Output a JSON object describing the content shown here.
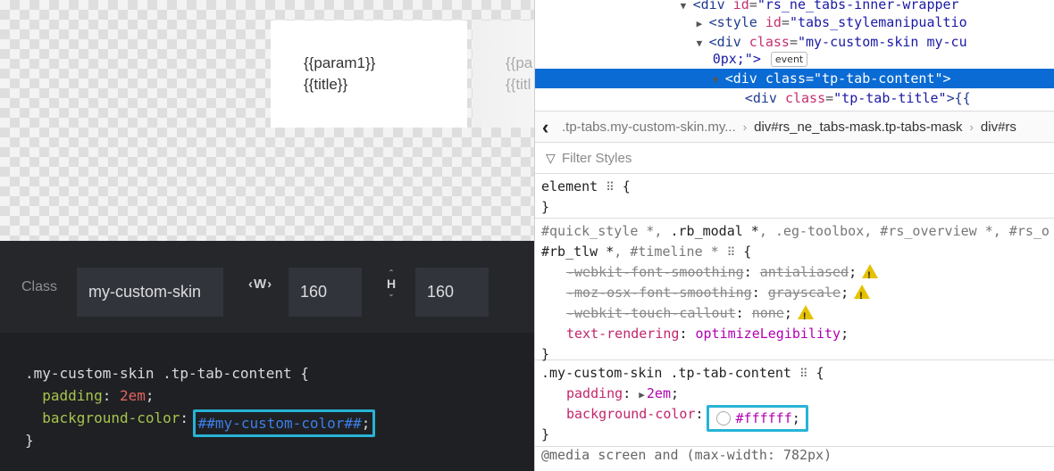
{
  "preview": {
    "card1": {
      "line1": "{{param1}}",
      "line2": "{{title}}"
    },
    "card2": {
      "line1": "{{pa",
      "line2": "{{titl"
    }
  },
  "classbar": {
    "class_label": "Class",
    "class_value": "my-custom-skin",
    "w_icon": "‹W›",
    "w_value": "160",
    "h_icon": "H",
    "h_value": "160"
  },
  "editor": {
    "line1": ".my-custom-skin .tp-tab-content {",
    "padding_prop": "padding",
    "padding_val": "2em",
    "bg_prop": "background-color",
    "bg_val": "##my-custom-color##",
    "close": "}"
  },
  "devtools": {
    "dom": [
      {
        "tag": "<div",
        "attr": "id",
        "val": "\"rs_ne_tabs-inner-wrapper"
      },
      {
        "tag": "<style",
        "attr": "id",
        "val": "\"tabs_stylemanipualtio"
      },
      {
        "tag": "<div",
        "attr": "class",
        "val": "\"my-custom-skin my-cu"
      },
      {
        "text": "0px;\">",
        "badge": "event"
      },
      {
        "tag": "<div",
        "attr": "class",
        "val": "\"tp-tab-content\"",
        "end": ">"
      },
      {
        "tag": "<div",
        "attr": "class",
        "val": "\"tp-tab-title\"",
        "end": ">{{"
      }
    ],
    "breadcrumbs": [
      ".tp-tabs.my-custom-skin.my...",
      "div#rs_ne_tabs-mask.tp-tabs-mask",
      "div#rs"
    ],
    "filter_placeholder": "Filter Styles",
    "rule_element": {
      "selector": "element",
      "close": "}"
    },
    "rule_quick": {
      "sel_line1_a": "#quick_style *, ",
      "sel_line1_b": ".rb_modal *",
      "sel_line1_c": ", .eg-toolbox, #rs_overview *, #rs_o",
      "sel_line2_a": "#rb_tlw *",
      "sel_line2_b": ", #timeline * ",
      "props": [
        {
          "name": "-webkit-font-smoothing",
          "value": "antialiased",
          "struck": true,
          "warn": true
        },
        {
          "name": "-moz-osx-font-smoothing",
          "value": "grayscale",
          "struck": true,
          "warn": true
        },
        {
          "name": "-webkit-touch-callout",
          "value": "none",
          "struck": true,
          "warn": true
        },
        {
          "name": "text-rendering",
          "value": "optimizeLegibility",
          "struck": false,
          "warn": false
        }
      ],
      "close": "}"
    },
    "rule_custom": {
      "selector": ".my-custom-skin .tp-tab-content",
      "padding_name": "padding",
      "padding_value": "2em",
      "bg_name": "background-color",
      "bg_value": "#ffffff",
      "close": "}"
    },
    "media": "@media screen and (max-width: 782px)"
  },
  "colors": {
    "highlight_border": "#28b3d6",
    "selection_blue": "#0a6bd4",
    "editor_bg": "#1f2023"
  }
}
